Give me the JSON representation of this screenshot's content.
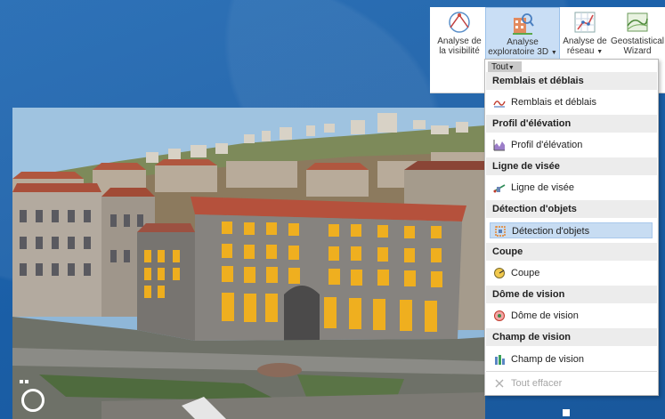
{
  "ribbon": {
    "buttons": [
      {
        "line1": "Analyse de",
        "line2": "la visibilité",
        "icon": "visibility-analysis-icon",
        "dropdown": false
      },
      {
        "line1": "Analyse",
        "line2": "exploratoire 3D",
        "icon": "exploratory-3d-icon",
        "dropdown": true
      },
      {
        "line1": "Analyse de",
        "line2": "réseau",
        "icon": "network-analysis-icon",
        "dropdown": true
      },
      {
        "line1": "Geostatistical",
        "line2": "Wizard",
        "icon": "geostatistical-wizard-icon",
        "dropdown": false
      }
    ]
  },
  "menu": {
    "filter_label": "Tout",
    "sections": [
      {
        "header": "Remblais et déblais",
        "item": "Remblais et déblais",
        "icon": "cut-fill-icon"
      },
      {
        "header": "Profil d'élévation",
        "item": "Profil d'élévation",
        "icon": "elevation-profile-icon"
      },
      {
        "header": "Ligne de visée",
        "item": "Ligne de visée",
        "icon": "line-of-sight-icon"
      },
      {
        "header": "Détection d'objets",
        "item": "Détection d'objets",
        "icon": "object-detection-icon"
      },
      {
        "header": "Coupe",
        "item": "Coupe",
        "icon": "slice-icon"
      },
      {
        "header": "Dôme de vision",
        "item": "Dôme de vision",
        "icon": "view-dome-icon"
      },
      {
        "header": "Champ de vision",
        "item": "Champ de vision",
        "icon": "viewshed-icon"
      }
    ],
    "clear_label": "Tout effacer",
    "selected_index": 3
  },
  "colors": {
    "background": "#1b5fa6",
    "selection": "#c7dcf2",
    "highlight_windows": "#f5b21a"
  }
}
